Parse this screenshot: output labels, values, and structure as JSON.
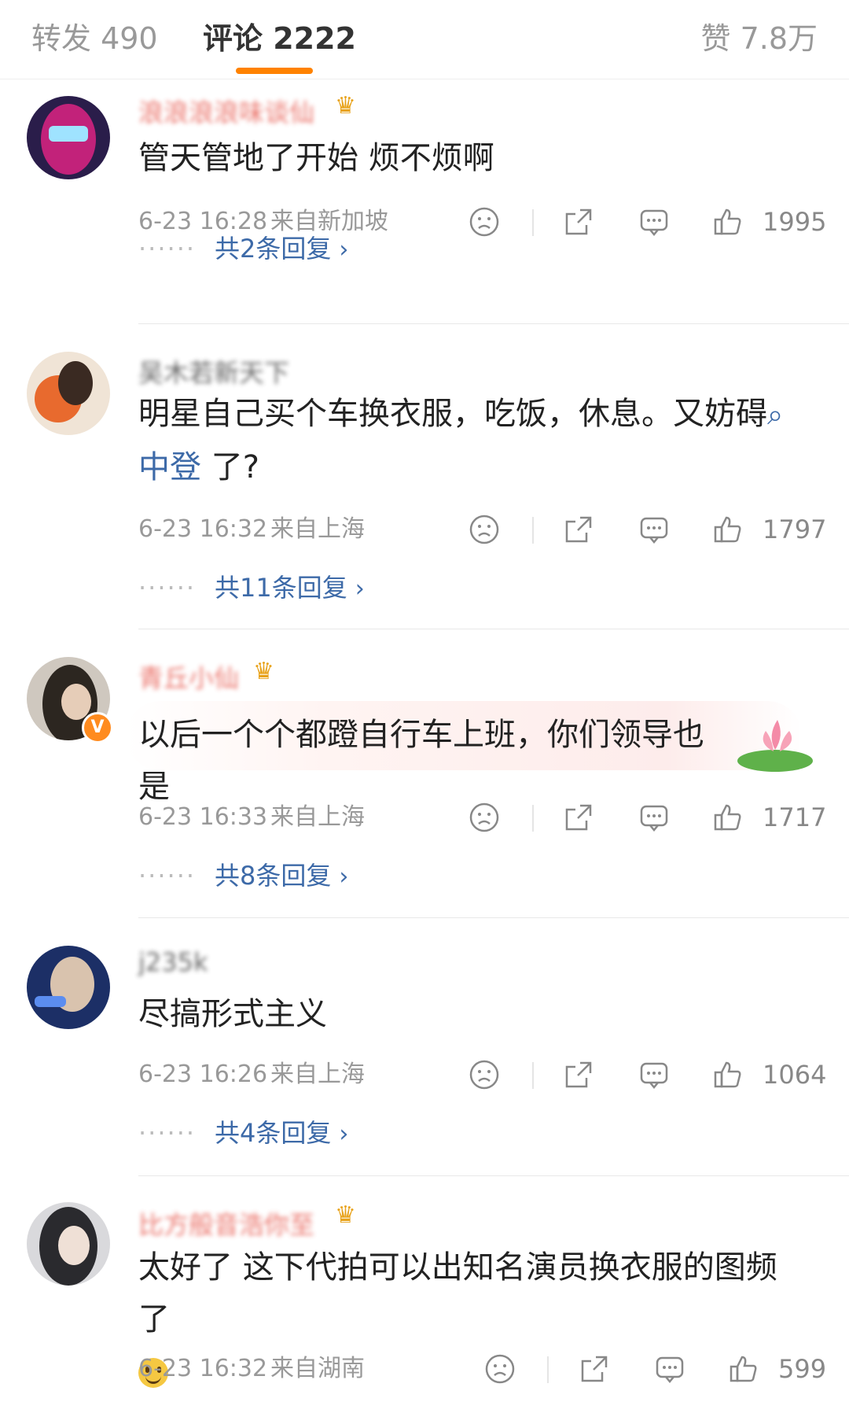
{
  "tabs": {
    "repost": "转发 490",
    "comment": "评论 2222",
    "like": "赞 7.8万"
  },
  "colors": {
    "accent": "#ff8200",
    "link": "#3d6aa8",
    "meta": "#999999"
  },
  "comments": [
    {
      "username": "浪浪浪浪味谈仙",
      "text": "管天管地了开始 烦不烦啊",
      "time": "6-23 16:28",
      "location": "来自新加坡",
      "likes": "1995",
      "replies": "共2条回复"
    },
    {
      "username": "吴木若新天下",
      "text_before": "明星自己买个车换衣服，吃饭，休息。又妨碍",
      "topic": "中登",
      "text_after": " 了?",
      "time": "6-23 16:32",
      "location": "来自上海",
      "likes": "1797",
      "replies": "共11条回复"
    },
    {
      "username": "青丘小仙",
      "text": "以后一个个都蹬自行车上班，你们领导也是",
      "time": "6-23 16:33",
      "location": "来自上海",
      "likes": "1717",
      "replies": "共8条回复"
    },
    {
      "username": "j235k",
      "text": "尽搞形式主义",
      "time": "6-23 16:26",
      "location": "来自上海",
      "likes": "1064",
      "replies": "共4条回复"
    },
    {
      "username": "比方般音浩你至",
      "text": "太好了 这下代拍可以出知名演员换衣服的图频了",
      "time": "6-23 16:32",
      "location": "来自湖南",
      "likes": "599"
    }
  ],
  "icons": [
    "sad-face-icon",
    "share-icon",
    "comment-icon",
    "thumbs-up-icon",
    "search-icon",
    "chevron-right-icon"
  ]
}
